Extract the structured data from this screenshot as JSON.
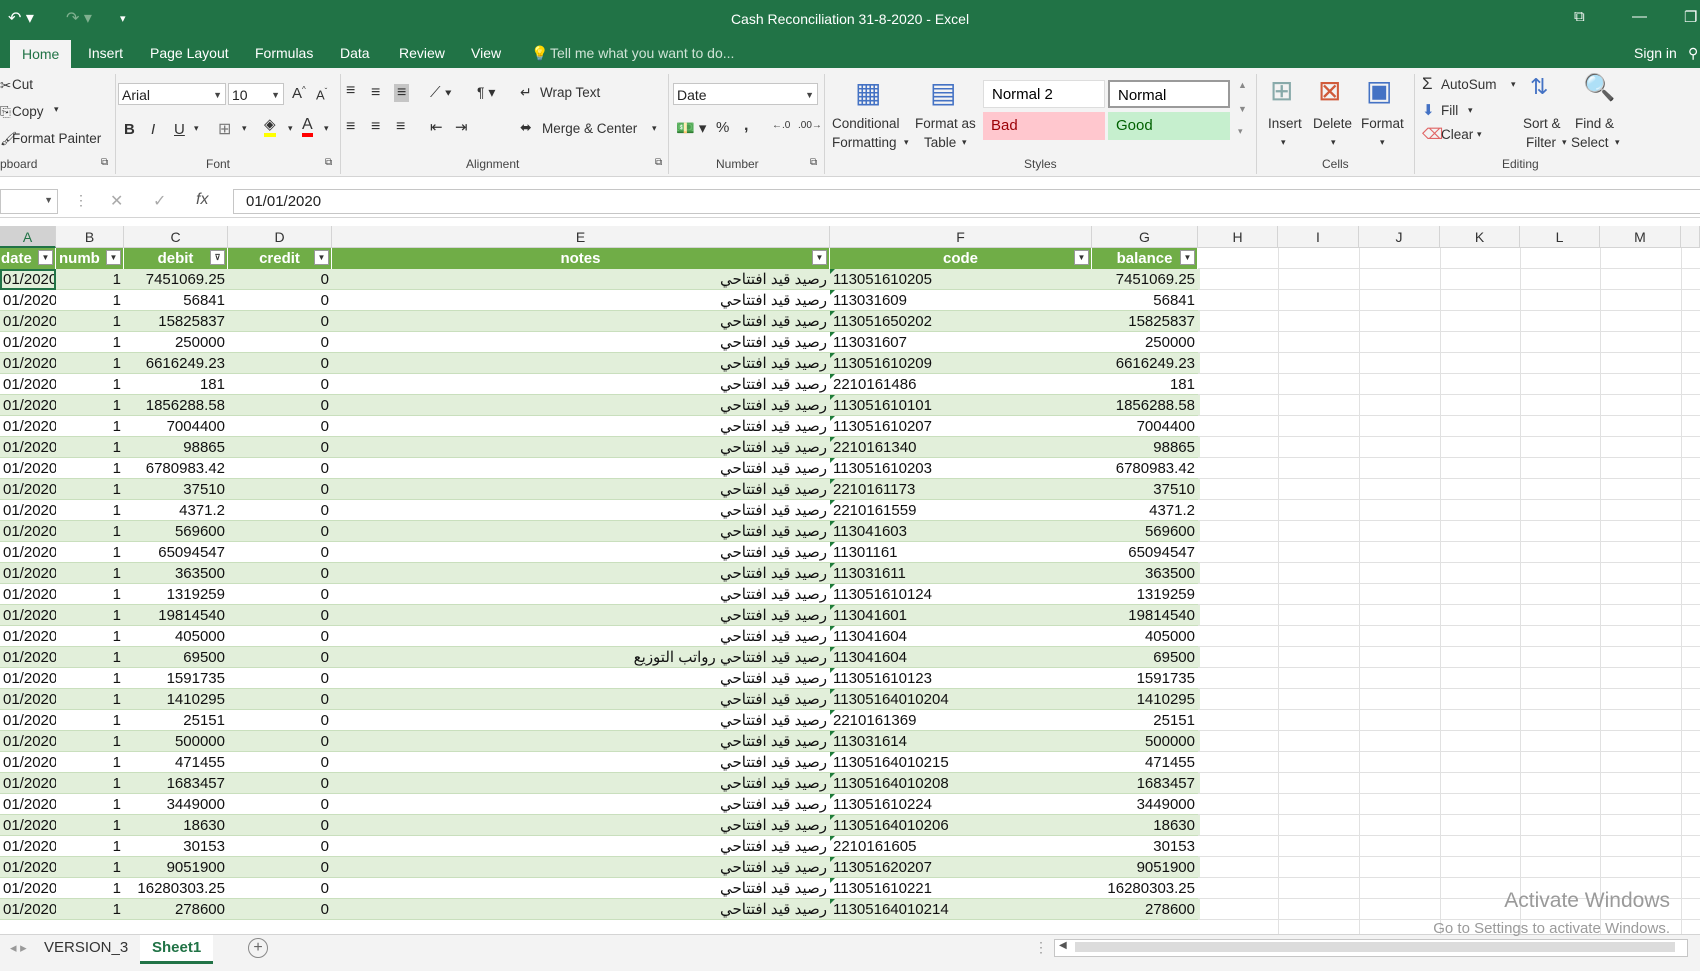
{
  "window": {
    "title": "Cash Reconciliation 31-8-2020 - Excel"
  },
  "quick_access": {
    "undo_icon": "undo-icon",
    "redo_icon": "redo-icon",
    "customize_icon": "customize-icon"
  },
  "tabs": [
    "Home",
    "Insert",
    "Page Layout",
    "Formulas",
    "Data",
    "Review",
    "View"
  ],
  "tell_me": "Tell me what you want to do...",
  "sign_in": "Sign in",
  "clipboard": {
    "cut": "Cut",
    "copy": "Copy",
    "format_painter": "Format Painter",
    "group": "pboard"
  },
  "font": {
    "name": "Arial",
    "size": "10",
    "group": "Font",
    "bold": "B",
    "italic": "I",
    "underline": "U"
  },
  "alignment": {
    "wrap_text": "Wrap Text",
    "merge_center": "Merge & Center",
    "group": "Alignment"
  },
  "number": {
    "format": "Date",
    "group": "Number",
    "percent": "%",
    "comma": ","
  },
  "styles": {
    "conditional": "Conditional",
    "conditional2": "Formatting",
    "format_as": "Format as",
    "format_as2": "Table",
    "normal2": "Normal 2",
    "normal": "Normal",
    "bad": "Bad",
    "good": "Good",
    "group": "Styles"
  },
  "cells_group": {
    "insert": "Insert",
    "delete": "Delete",
    "format": "Format",
    "group": "Cells"
  },
  "editing": {
    "autosum": "AutoSum",
    "fill": "Fill",
    "clear": "Clear",
    "sort": "Sort &",
    "sort2": "Filter",
    "find": "Find &",
    "find2": "Select",
    "group": "Editing"
  },
  "formula_bar": {
    "value": "01/01/2020",
    "fx": "fx"
  },
  "columns": [
    "A",
    "B",
    "C",
    "D",
    "E",
    "F",
    "G",
    "H",
    "I",
    "J",
    "K",
    "L",
    "M"
  ],
  "table_headers": [
    "date",
    "numb",
    "debit",
    "credit",
    "notes",
    "code",
    "balance"
  ],
  "rows": [
    [
      "01/2020",
      "1",
      "7451069.25",
      "0",
      "رصيد قيد افتتاحي",
      "113051610205",
      "7451069.25"
    ],
    [
      "01/2020",
      "1",
      "56841",
      "0",
      "رصيد قيد افتتاحي",
      "113031609",
      "56841"
    ],
    [
      "01/2020",
      "1",
      "15825837",
      "0",
      "رصيد قيد افتتاحي",
      "113051650202",
      "15825837"
    ],
    [
      "01/2020",
      "1",
      "250000",
      "0",
      "رصيد قيد افتتاحي",
      "113031607",
      "250000"
    ],
    [
      "01/2020",
      "1",
      "6616249.23",
      "0",
      "رصيد قيد افتتاحي",
      "113051610209",
      "6616249.23"
    ],
    [
      "01/2020",
      "1",
      "181",
      "0",
      "رصيد قيد افتتاحي",
      "2210161486",
      "181"
    ],
    [
      "01/2020",
      "1",
      "1856288.58",
      "0",
      "رصيد قيد افتتاحي",
      "113051610101",
      "1856288.58"
    ],
    [
      "01/2020",
      "1",
      "7004400",
      "0",
      "رصيد قيد افتتاحي",
      "113051610207",
      "7004400"
    ],
    [
      "01/2020",
      "1",
      "98865",
      "0",
      "رصيد قيد افتتاحي",
      "2210161340",
      "98865"
    ],
    [
      "01/2020",
      "1",
      "6780983.42",
      "0",
      "رصيد قيد افتتاحي",
      "113051610203",
      "6780983.42"
    ],
    [
      "01/2020",
      "1",
      "37510",
      "0",
      "رصيد قيد افتتاحي",
      "2210161173",
      "37510"
    ],
    [
      "01/2020",
      "1",
      "4371.2",
      "0",
      "رصيد قيد افتتاحي",
      "2210161559",
      "4371.2"
    ],
    [
      "01/2020",
      "1",
      "569600",
      "0",
      "رصيد قيد افتتاحي",
      "113041603",
      "569600"
    ],
    [
      "01/2020",
      "1",
      "65094547",
      "0",
      "رصيد قيد افتتاحي",
      "11301161",
      "65094547"
    ],
    [
      "01/2020",
      "1",
      "363500",
      "0",
      "رصيد قيد افتتاحي",
      "113031611",
      "363500"
    ],
    [
      "01/2020",
      "1",
      "1319259",
      "0",
      "رصيد قيد افتتاحي",
      "113051610124",
      "1319259"
    ],
    [
      "01/2020",
      "1",
      "19814540",
      "0",
      "رصيد قيد افتتاحي",
      "113041601",
      "19814540"
    ],
    [
      "01/2020",
      "1",
      "405000",
      "0",
      "رصيد قيد افتتاحي",
      "113041604",
      "405000"
    ],
    [
      "01/2020",
      "1",
      "69500",
      "0",
      "رصيد قيد افتتاحي رواتب التوزيع",
      "113041604",
      "69500"
    ],
    [
      "01/2020",
      "1",
      "1591735",
      "0",
      "رصيد قيد افتتاحي",
      "113051610123",
      "1591735"
    ],
    [
      "01/2020",
      "1",
      "1410295",
      "0",
      "رصيد قيد افتتاحي",
      "113051640102​04",
      "1410295"
    ],
    [
      "01/2020",
      "1",
      "25151",
      "0",
      "رصيد قيد افتتاحي",
      "2210161369",
      "25151"
    ],
    [
      "01/2020",
      "1",
      "500000",
      "0",
      "رصيد قيد افتتاحي",
      "113031614",
      "500000"
    ],
    [
      "01/2020",
      "1",
      "471455",
      "0",
      "رصيد قيد افتتاحي",
      "113051640102​15",
      "471455"
    ],
    [
      "01/2020",
      "1",
      "1683457",
      "0",
      "رصيد قيد افتتاحي",
      "113051640102​08",
      "1683457"
    ],
    [
      "01/2020",
      "1",
      "3449000",
      "0",
      "رصيد قيد افتتاحي",
      "113051610224",
      "3449000"
    ],
    [
      "01/2020",
      "1",
      "18630",
      "0",
      "رصيد قيد افتتاحي",
      "113051640102​06",
      "18630"
    ],
    [
      "01/2020",
      "1",
      "30153",
      "0",
      "رصيد قيد افتتاحي",
      "2210161605",
      "30153"
    ],
    [
      "01/2020",
      "1",
      "9051900",
      "0",
      "رصيد قيد افتتاحي",
      "113051620207",
      "9051900"
    ],
    [
      "01/2020",
      "1",
      "16280303.25",
      "0",
      "رصيد قيد افتتاحي",
      "113051610221",
      "16280303.25"
    ],
    [
      "01/2020",
      "1",
      "278600",
      "0",
      "رصيد قيد افتتاحي",
      "113051640102​14",
      "278600"
    ]
  ],
  "sheets": [
    "VERSION_3",
    "Sheet1"
  ],
  "watermark": {
    "line1": "Activate Windows",
    "line2": "Go to Settings to activate Windows."
  },
  "colors": {
    "excel_green": "#217346",
    "table_header": "#70ad47",
    "band": "#e2efda",
    "bad_bg": "#ffc7ce",
    "bad_fg": "#9c0006",
    "good_bg": "#c6efce",
    "good_fg": "#006100"
  }
}
